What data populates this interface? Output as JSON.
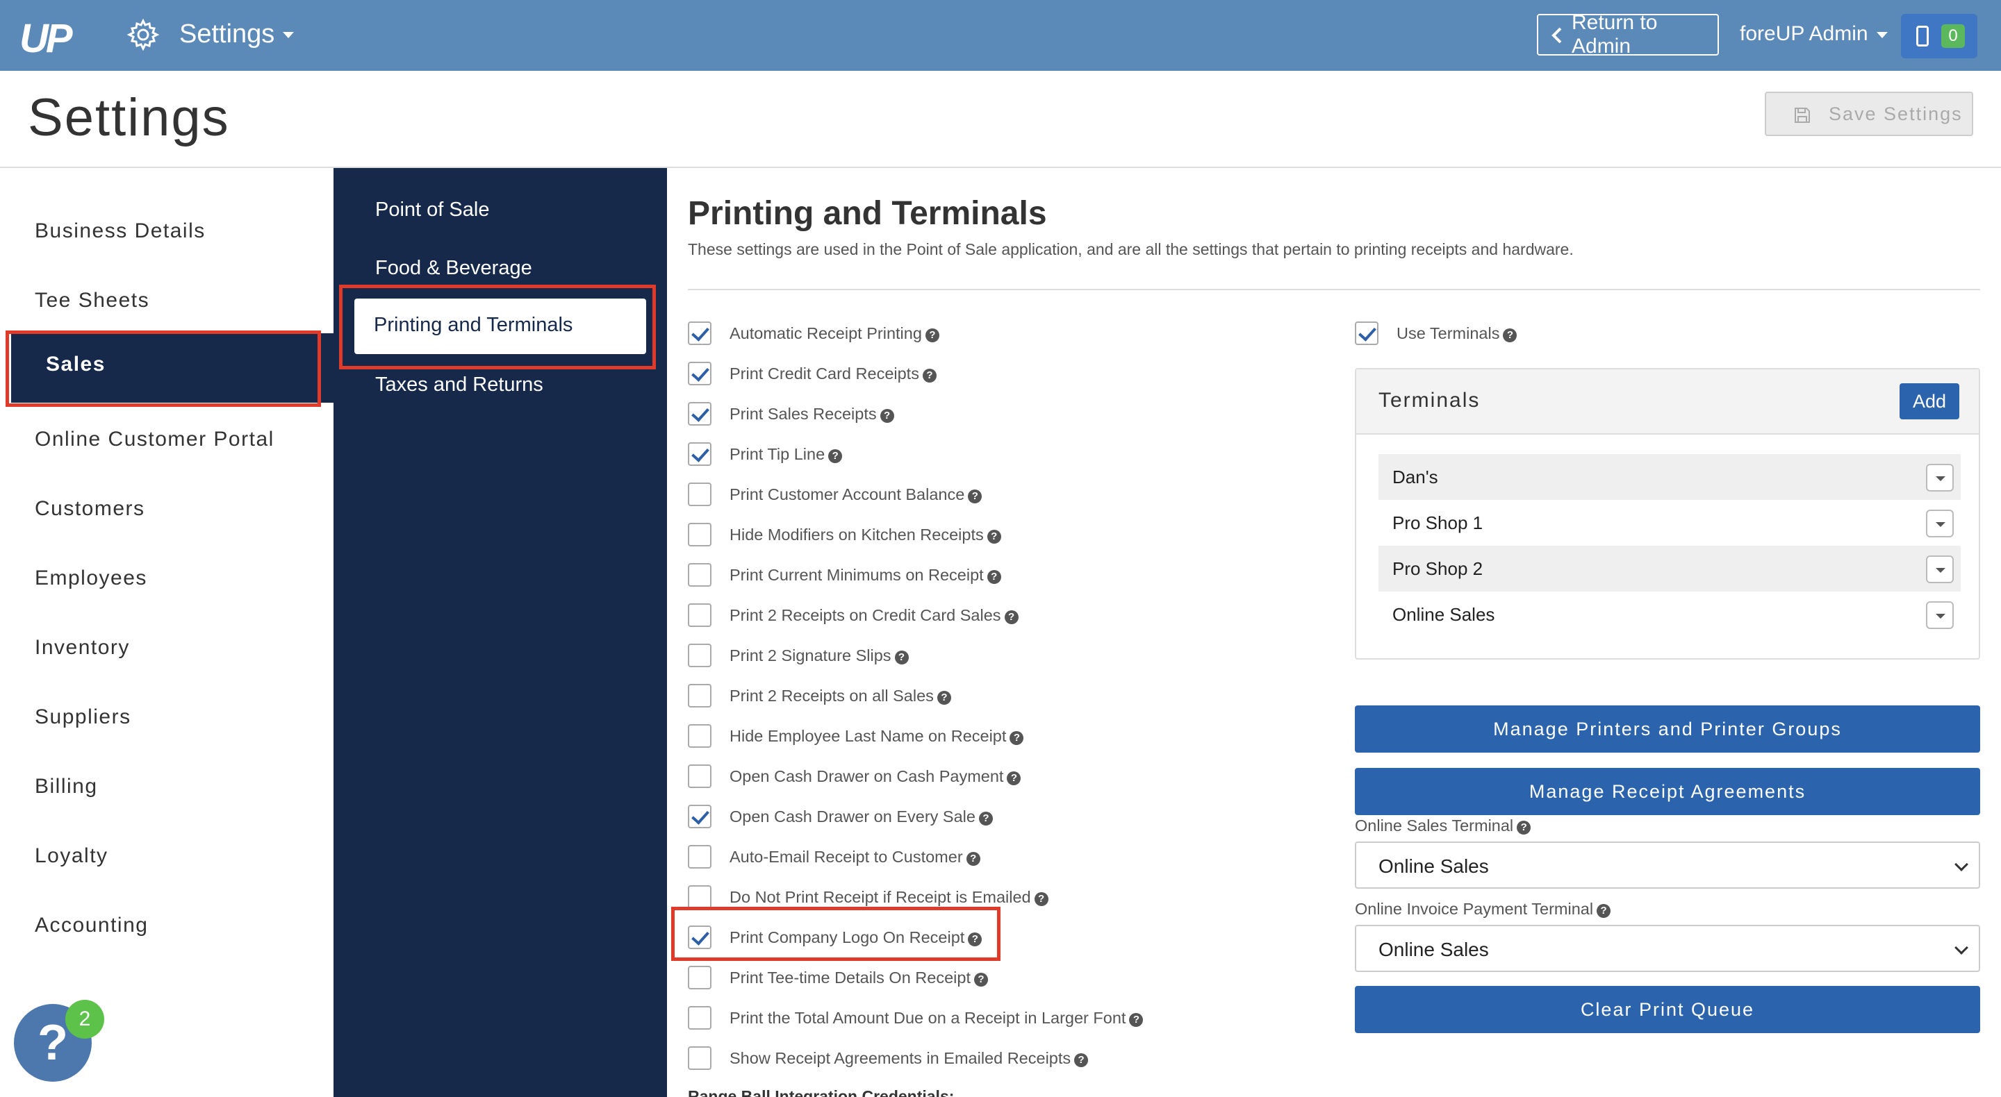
{
  "topnav": {
    "logo": "UP",
    "section_label": "Settings",
    "return_label": "Return to Admin",
    "user_label": "foreUP Admin",
    "device_count": "0"
  },
  "header": {
    "title": "Settings",
    "save_label": "Save Settings"
  },
  "sidebar": {
    "items": [
      {
        "label": "Business Details"
      },
      {
        "label": "Tee Sheets"
      },
      {
        "label": "Sales"
      },
      {
        "label": "Online Customer Portal"
      },
      {
        "label": "Customers"
      },
      {
        "label": "Employees"
      },
      {
        "label": "Inventory"
      },
      {
        "label": "Suppliers"
      },
      {
        "label": "Billing"
      },
      {
        "label": "Loyalty"
      },
      {
        "label": "Accounting"
      }
    ],
    "active": "Sales"
  },
  "subnav": {
    "items": [
      {
        "label": "Point of Sale"
      },
      {
        "label": "Food & Beverage"
      },
      {
        "label": "Printing and Terminals"
      },
      {
        "label": "Taxes and Returns"
      }
    ],
    "active": "Printing and Terminals"
  },
  "main": {
    "title": "Printing and Terminals",
    "description": "These settings are used in the Point of Sale application, and are all the settings that pertain to printing receipts and hardware.",
    "options": [
      {
        "label": "Automatic Receipt Printing",
        "checked": true
      },
      {
        "label": "Print Credit Card Receipts",
        "checked": true
      },
      {
        "label": "Print Sales Receipts",
        "checked": true
      },
      {
        "label": "Print Tip Line",
        "checked": true
      },
      {
        "label": "Print Customer Account Balance",
        "checked": false
      },
      {
        "label": "Hide Modifiers on Kitchen Receipts",
        "checked": false
      },
      {
        "label": "Print Current Minimums on Receipt",
        "checked": false
      },
      {
        "label": "Print 2 Receipts on Credit Card Sales",
        "checked": false
      },
      {
        "label": "Print 2 Signature Slips",
        "checked": false
      },
      {
        "label": "Print 2 Receipts on all Sales",
        "checked": false
      },
      {
        "label": "Hide Employee Last Name on Receipt",
        "checked": false
      },
      {
        "label": "Open Cash Drawer on Cash Payment",
        "checked": false
      },
      {
        "label": "Open Cash Drawer on Every Sale",
        "checked": true
      },
      {
        "label": "Auto-Email Receipt to Customer",
        "checked": false
      },
      {
        "label": "Do Not Print Receipt if Receipt is Emailed",
        "checked": false
      },
      {
        "label": "Print Company Logo On Receipt",
        "checked": true
      },
      {
        "label": "Print Tee-time Details On Receipt",
        "checked": false
      },
      {
        "label": "Print the Total Amount Due on a Receipt in Larger Font",
        "checked": false
      },
      {
        "label": "Show Receipt Agreements in Emailed Receipts",
        "checked": false
      }
    ],
    "cut_heading": "Range Ball Integration Credentials:"
  },
  "terminals": {
    "use_label": "Use Terminals",
    "use_checked": true,
    "panel_title": "Terminals",
    "add_label": "Add",
    "items": [
      {
        "name": "Dan's"
      },
      {
        "name": "Pro Shop 1"
      },
      {
        "name": "Pro Shop 2"
      },
      {
        "name": "Online Sales"
      }
    ],
    "manage_printers_label": "Manage Printers and Printer Groups",
    "manage_agreements_label": "Manage Receipt Agreements",
    "online_sales_label": "Online Sales Terminal",
    "online_sales_value": "Online Sales",
    "invoice_label": "Online Invoice Payment Terminal",
    "invoice_value": "Online Sales",
    "clear_label": "Clear Print Queue"
  },
  "help_widget": {
    "glyph": "?",
    "badge": "2"
  },
  "colors": {
    "topnav": "#5b89b8",
    "navy": "#16294b",
    "primary": "#2b63ad",
    "highlight": "#e03a2a"
  }
}
